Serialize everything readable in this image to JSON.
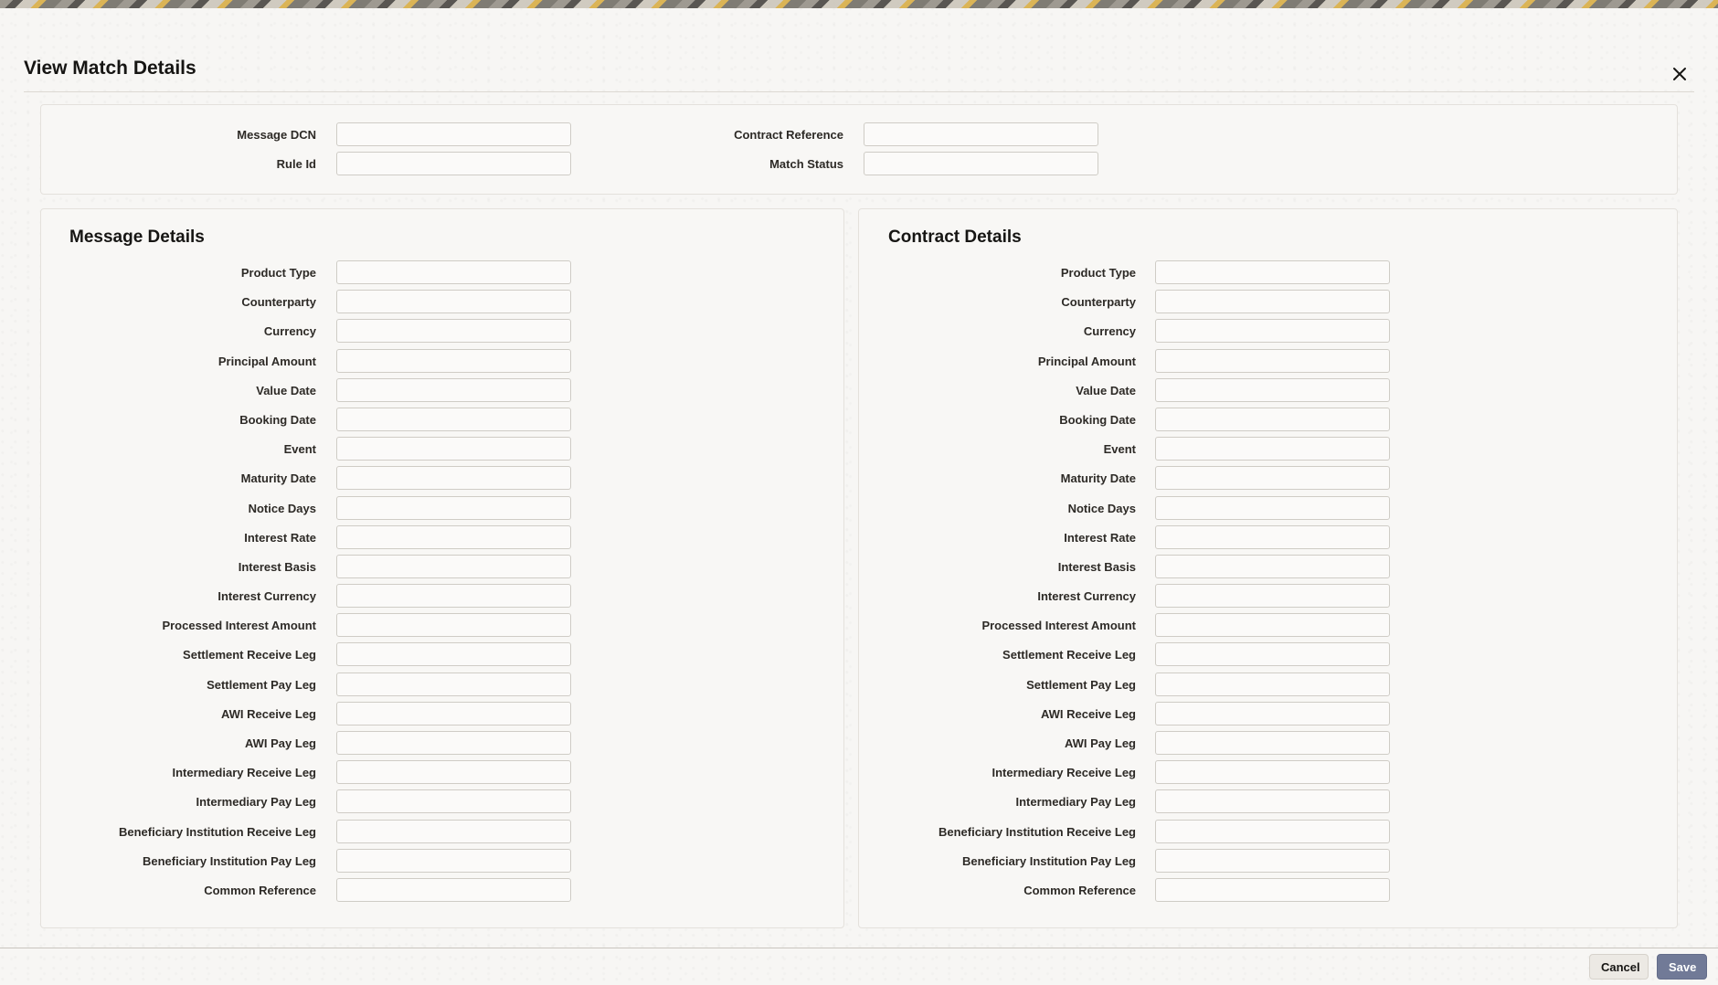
{
  "dialog": {
    "title": "View Match Details",
    "close_icon": "close-icon"
  },
  "header_fields": {
    "message_dcn": {
      "label": "Message DCN",
      "value": ""
    },
    "rule_id": {
      "label": "Rule Id",
      "value": ""
    },
    "contract_reference": {
      "label": "Contract Reference",
      "value": ""
    },
    "match_status": {
      "label": "Match Status",
      "value": ""
    }
  },
  "message_details": {
    "title": "Message Details",
    "fields": [
      {
        "label": "Product Type",
        "value": ""
      },
      {
        "label": "Counterparty",
        "value": ""
      },
      {
        "label": "Currency",
        "value": ""
      },
      {
        "label": "Principal Amount",
        "value": ""
      },
      {
        "label": "Value Date",
        "value": ""
      },
      {
        "label": "Booking Date",
        "value": ""
      },
      {
        "label": "Event",
        "value": ""
      },
      {
        "label": "Maturity Date",
        "value": ""
      },
      {
        "label": "Notice Days",
        "value": ""
      },
      {
        "label": "Interest Rate",
        "value": ""
      },
      {
        "label": "Interest Basis",
        "value": ""
      },
      {
        "label": "Interest Currency",
        "value": ""
      },
      {
        "label": "Processed Interest Amount",
        "value": ""
      },
      {
        "label": "Settlement Receive Leg",
        "value": ""
      },
      {
        "label": "Settlement Pay Leg",
        "value": ""
      },
      {
        "label": "AWI Receive Leg",
        "value": ""
      },
      {
        "label": "AWI Pay Leg",
        "value": ""
      },
      {
        "label": "Intermediary Receive Leg",
        "value": ""
      },
      {
        "label": "Intermediary Pay Leg",
        "value": ""
      },
      {
        "label": "Beneficiary Institution Receive Leg",
        "value": ""
      },
      {
        "label": "Beneficiary Institution Pay Leg",
        "value": ""
      },
      {
        "label": "Common Reference",
        "value": ""
      }
    ]
  },
  "contract_details": {
    "title": "Contract Details",
    "fields": [
      {
        "label": "Product Type",
        "value": ""
      },
      {
        "label": "Counterparty",
        "value": ""
      },
      {
        "label": "Currency",
        "value": ""
      },
      {
        "label": "Principal Amount",
        "value": ""
      },
      {
        "label": "Value Date",
        "value": ""
      },
      {
        "label": "Booking Date",
        "value": ""
      },
      {
        "label": "Event",
        "value": ""
      },
      {
        "label": "Maturity Date",
        "value": ""
      },
      {
        "label": "Notice Days",
        "value": ""
      },
      {
        "label": "Interest Rate",
        "value": ""
      },
      {
        "label": "Interest Basis",
        "value": ""
      },
      {
        "label": "Interest Currency",
        "value": ""
      },
      {
        "label": "Processed Interest Amount",
        "value": ""
      },
      {
        "label": "Settlement Receive Leg",
        "value": ""
      },
      {
        "label": "Settlement Pay Leg",
        "value": ""
      },
      {
        "label": "AWI Receive Leg",
        "value": ""
      },
      {
        "label": "AWI Pay Leg",
        "value": ""
      },
      {
        "label": "Intermediary Receive Leg",
        "value": ""
      },
      {
        "label": "Intermediary Pay Leg",
        "value": ""
      },
      {
        "label": "Beneficiary Institution Receive Leg",
        "value": ""
      },
      {
        "label": "Beneficiary Institution Pay Leg",
        "value": ""
      },
      {
        "label": "Common Reference",
        "value": ""
      }
    ]
  },
  "footer": {
    "cancel_label": "Cancel",
    "save_label": "Save"
  },
  "colors": {
    "primary_button": "#717a97",
    "text": "#161513",
    "panel_bg": "#f8f7f5"
  }
}
